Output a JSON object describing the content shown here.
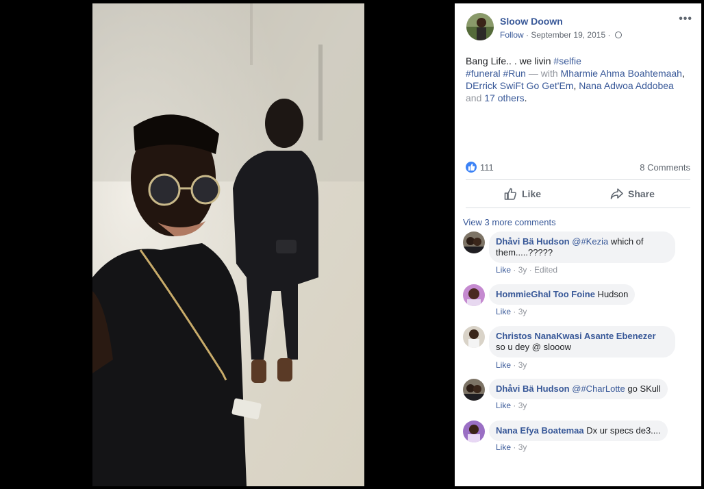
{
  "post": {
    "author": "Sloow Doown",
    "follow_label": "Follow",
    "date": "September 19, 2015",
    "more_label": "•••",
    "text_lead": "Bang Life.. . we livin",
    "hashtag_1": "#selfie",
    "hashtag_2": "#funeral",
    "hashtag_3": "#Run",
    "with_label": "— with",
    "tagged_1": "Mharmie Ahma Boahtemaah",
    "tagged_2": "DErrick SwiFt Go Get'Em",
    "tagged_3": "Nana Adwoa Addobea",
    "and_label": "and",
    "others_label": "17 others",
    "like_count": "111",
    "comments_count": "8 Comments",
    "like_button": "Like",
    "share_button": "Share"
  },
  "comments_section": {
    "view_more": "View 3 more comments",
    "items": [
      {
        "name": "Dhåvi Bä Hudson",
        "tag": "@#Kezia",
        "text": " which of them.....?????",
        "like": "Like",
        "time": "3y",
        "edited": "Edited"
      },
      {
        "name": "HommieGhal Too Foine",
        "tag": "",
        "text": " Hudson",
        "like": "Like",
        "time": "3y",
        "edited": ""
      },
      {
        "name": "Christos NanaKwasi Asante Ebenezer",
        "tag": "",
        "text": "so u dey @ slooow",
        "like": "Like",
        "time": "3y",
        "edited": ""
      },
      {
        "name": "Dhåvi Bä Hudson",
        "tag": "@#CharLotte",
        "text": " go SKull",
        "like": "Like",
        "time": "3y",
        "edited": ""
      },
      {
        "name": "Nana Efya Boatemaa",
        "tag": "",
        "text": " Dx ur specs de3....",
        "like": "Like",
        "time": "3y",
        "edited": ""
      }
    ]
  },
  "colors": {
    "link": "#385898",
    "muted": "#606770",
    "bubble": "#f2f3f5",
    "like_blue": "#3b82f6"
  }
}
